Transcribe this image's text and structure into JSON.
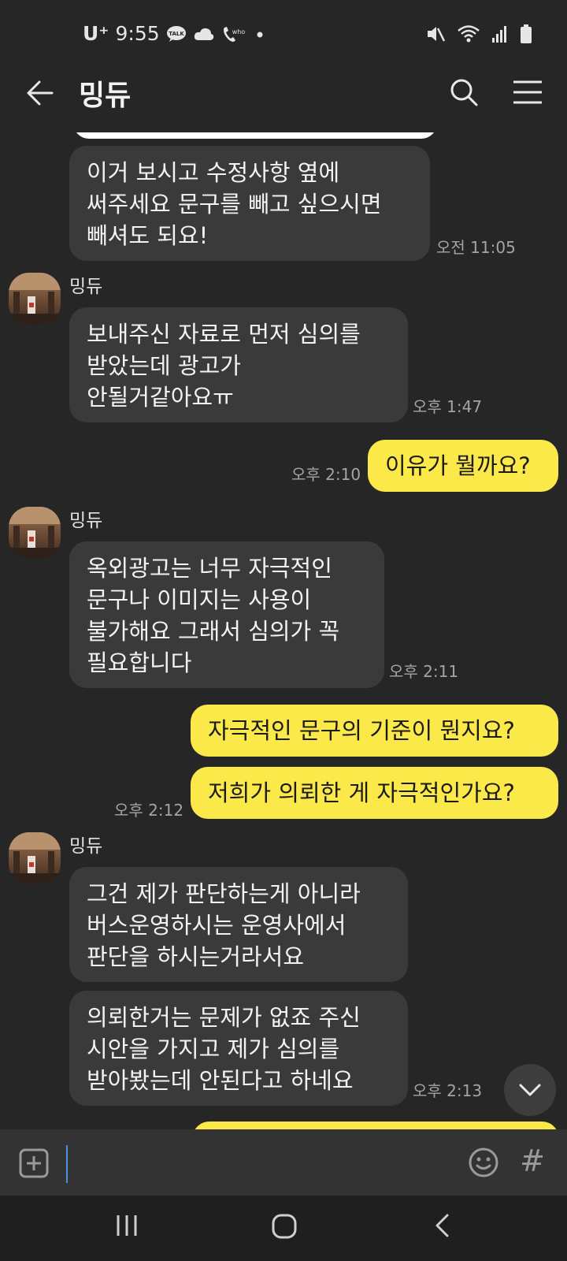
{
  "status_bar": {
    "carrier": "U⁺",
    "time": "9:55",
    "icons": [
      "talk-icon",
      "cloud-icon",
      "phone-whoo-icon",
      "dot-icon",
      "mute-icon",
      "wifi-icon",
      "signal-icon",
      "battery-icon"
    ],
    "talk_badge": "TALK",
    "whoo_label": "who"
  },
  "header": {
    "title": "밍듀",
    "back_icon": "back-arrow-icon",
    "search_icon": "search-icon",
    "menu_icon": "menu-icon"
  },
  "chat": {
    "messages": [
      {
        "sender": "",
        "text": "이거 보시고 수정사항 옆에\n써주세요 문구를 빼고 싶으시면\n빼셔도 되요!",
        "time": "오전 11:05",
        "mine": false
      },
      {
        "sender": "밍듀",
        "text": "보내주신 자료로 먼저 심의를\n받았는데 광고가\n안될거같아요ㅠ",
        "time": "오후 1:47",
        "mine": false
      },
      {
        "sender": "",
        "text": "이유가 뭘까요?",
        "time": "오후 2:10",
        "mine": true
      },
      {
        "sender": "밍듀",
        "text": "옥외광고는 너무 자극적인\n문구나 이미지는 사용이\n불가해요 그래서 심의가 꼭\n필요합니다",
        "time": "오후 2:11",
        "mine": false
      },
      {
        "sender": "",
        "text": "자극적인 문구의 기준이 뭔지요?",
        "time": "",
        "mine": true
      },
      {
        "sender": "",
        "text": "저희가 의뢰한 게 자극적인가요?",
        "time": "오후 2:12",
        "mine": true
      },
      {
        "sender": "밍듀",
        "text": "그건 제가 판단하는게 아니라\n버스운영하시는 운영사에서\n판단을 하시는거라서요",
        "time": "",
        "mine": false
      },
      {
        "sender": "",
        "text": "의뢰한거는 문제가 없죠 주신\n시안을 가지고 제가 심의를\n받아봤는데 안된다고 하네요",
        "time": "오후 2:13",
        "mine": false
      }
    ]
  },
  "input_bar": {
    "plus_icon": "plus-icon",
    "emoji_icon": "emoji-icon",
    "hash_label": "#"
  },
  "nav_bar": {
    "icons": [
      "recent-apps-icon",
      "home-icon",
      "back-icon"
    ]
  },
  "colors": {
    "background": "#262626",
    "incoming_bubble": "#3a3a3a",
    "outgoing_bubble": "#fbe94a",
    "timestamp": "#a4a4a4"
  }
}
